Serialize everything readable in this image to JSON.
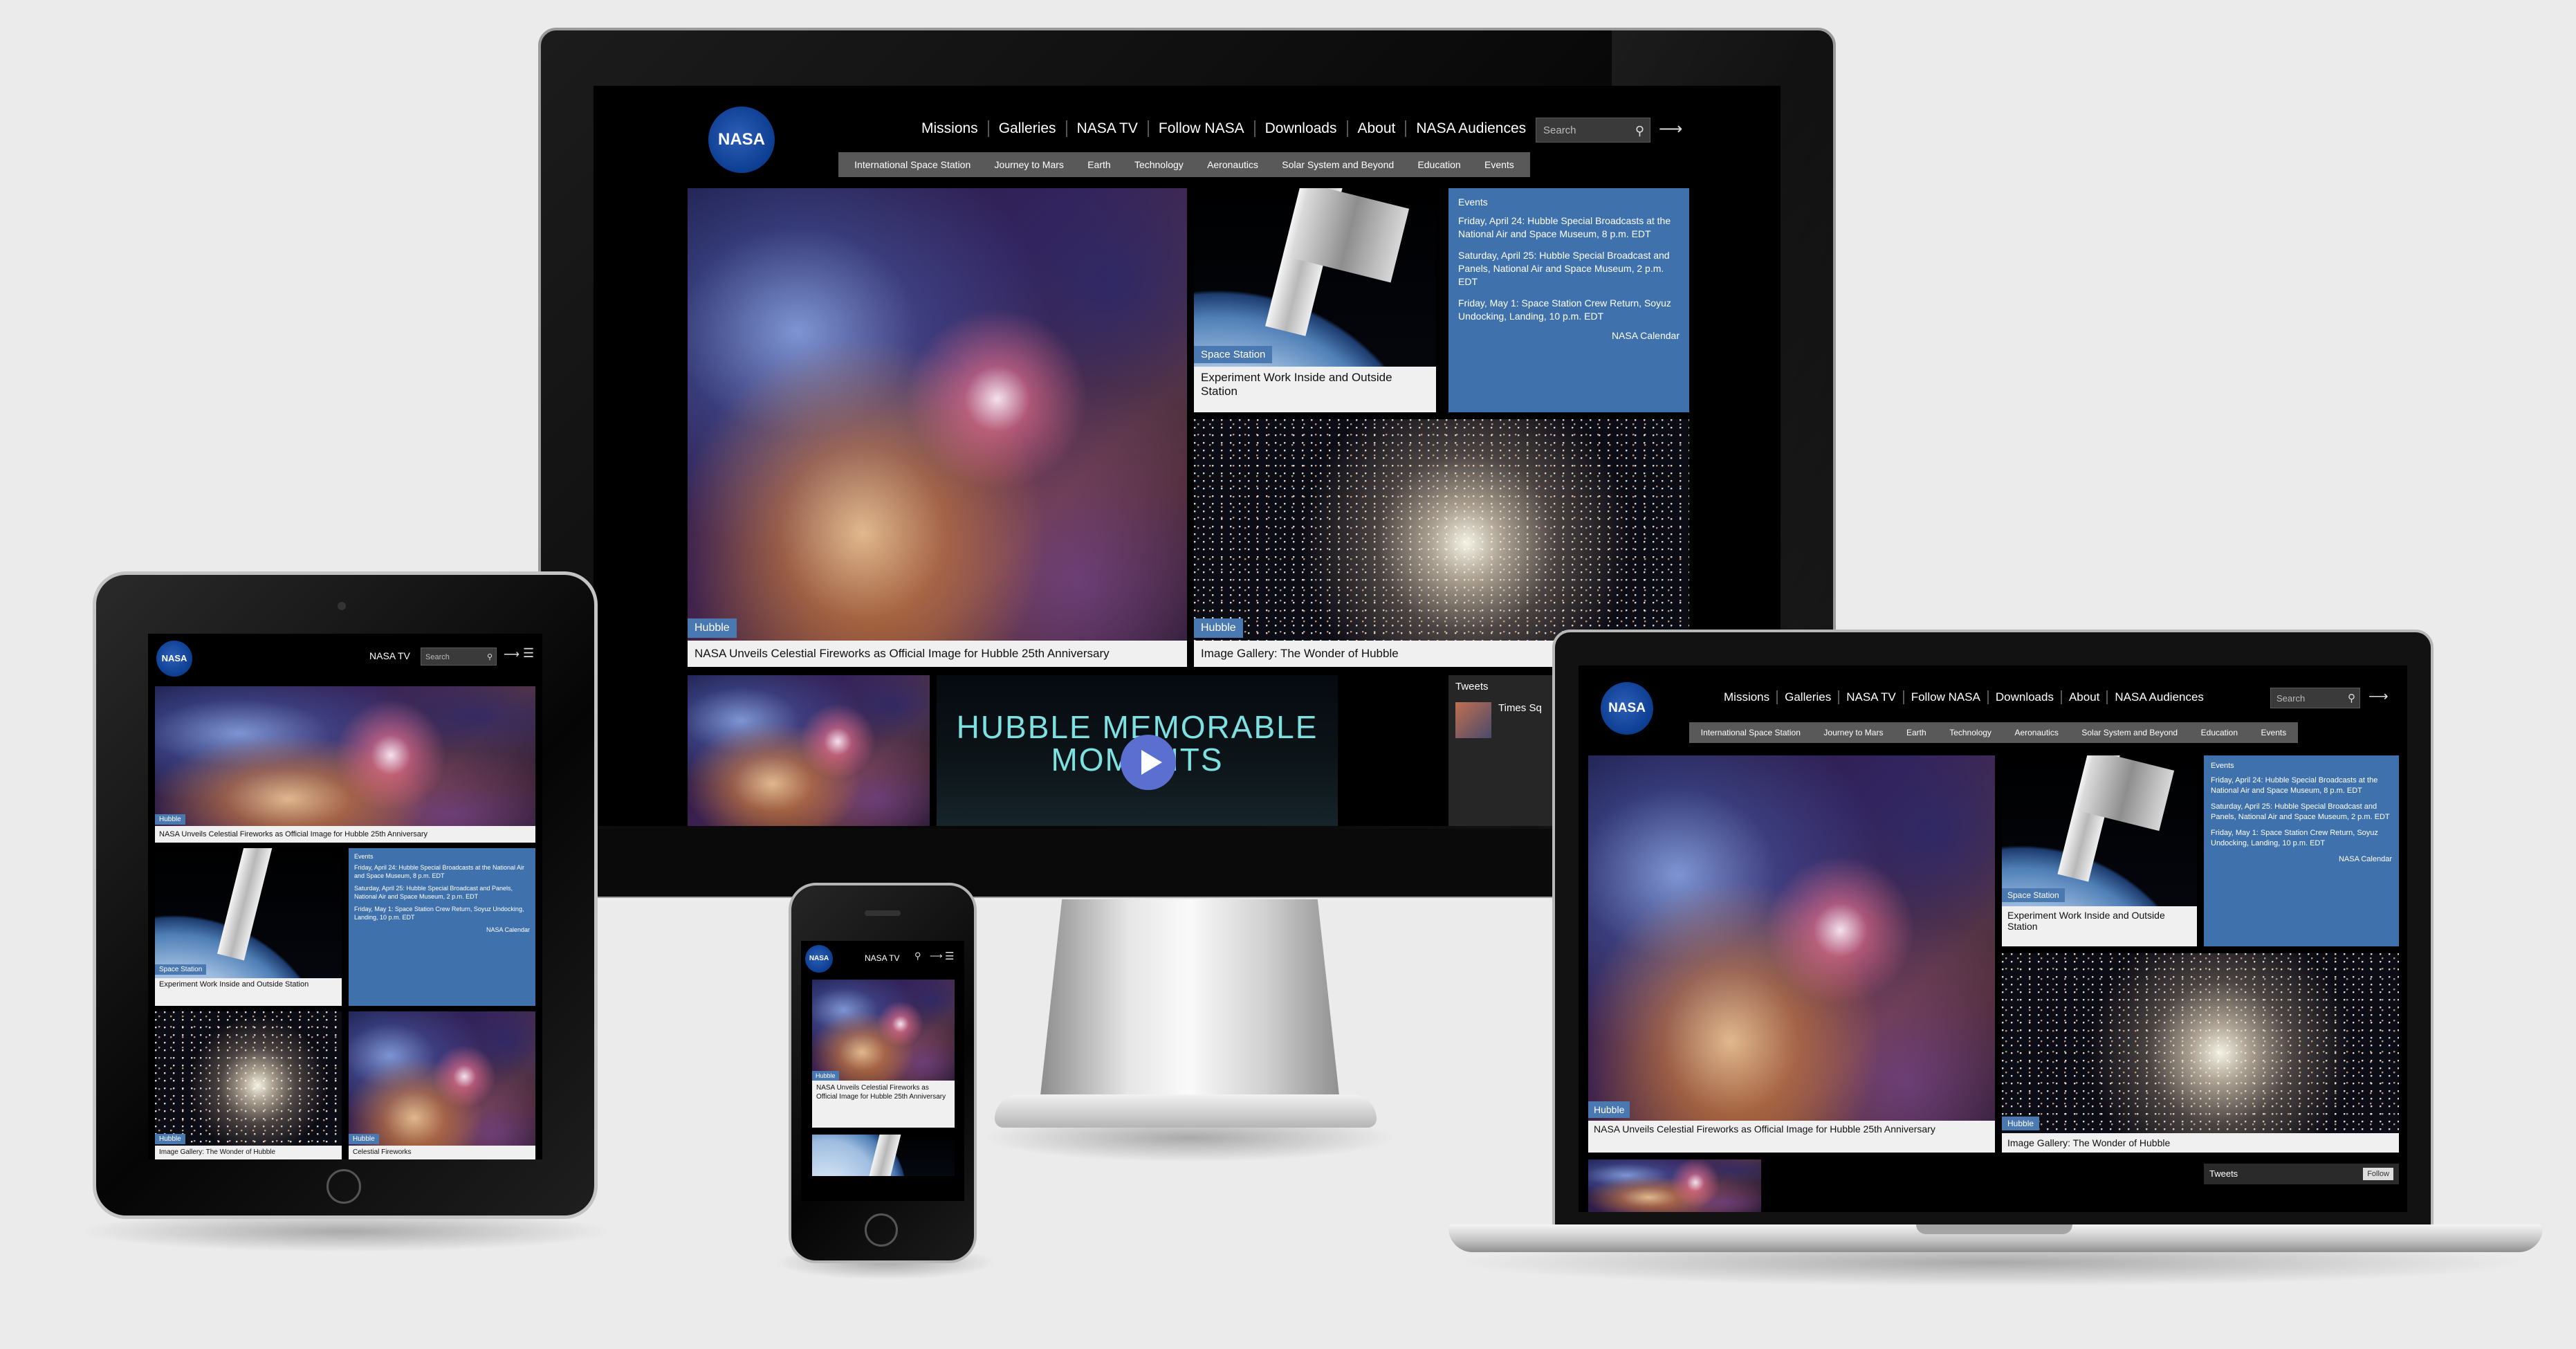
{
  "nav": {
    "links": [
      "Missions",
      "Galleries",
      "NASA TV",
      "Follow NASA",
      "Downloads",
      "About",
      "NASA Audiences"
    ],
    "search_placeholder": "Search",
    "sub": [
      "International Space Station",
      "Journey to Mars",
      "Earth",
      "Technology",
      "Aeronautics",
      "Solar System and Beyond",
      "Education",
      "Events"
    ]
  },
  "feature": {
    "tag": "Hubble",
    "title": "NASA Unveils Celestial Fireworks as Official Image for Hubble 25th Anniversary"
  },
  "station": {
    "tag": "Space Station",
    "title": "Experiment Work Inside and Outside Station"
  },
  "gallery": {
    "tag": "Hubble",
    "title": "Image Gallery: The Wonder of Hubble"
  },
  "events": {
    "heading": "Events",
    "items": [
      "Friday, April 24: Hubble Special Broadcasts at the National Air and Space Museum, 8 p.m. EDT",
      "Saturday, April 25: Hubble Special Broadcast and Panels, National Air and Space Museum, 2 p.m. EDT",
      "Friday, May 1: Space Station Crew Return, Soyuz Undocking, Landing, 10 p.m. EDT"
    ],
    "link": "NASA Calendar"
  },
  "video": {
    "title_line1": "HUBBLE MEMORABLE",
    "title_line2": "MOMENTS"
  },
  "tweets": {
    "heading": "Tweets",
    "name": "Times Sq"
  },
  "tablet": {
    "nav": "NASA TV",
    "event_link": "NASA Calendar",
    "fireworks_tag": "Hubble",
    "fireworks_title": "Celestial Fireworks"
  },
  "phone": {
    "nav": "NASA TV",
    "tag": "Hubble",
    "title": "NASA Unveils Celestial Fireworks as Official Image for Hubble 25th Anniversary"
  },
  "laptop": {
    "tweets": "Tweets",
    "follow": "Follow"
  },
  "brand": {
    "logo": "NASA"
  }
}
